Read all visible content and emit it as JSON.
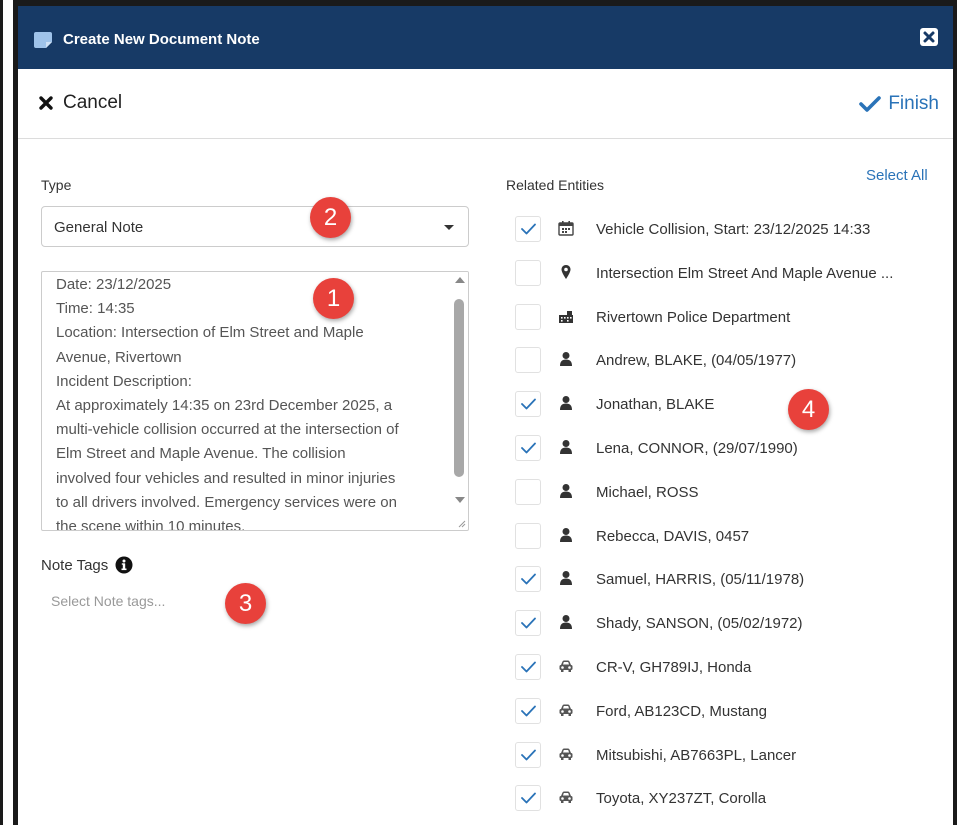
{
  "dialog": {
    "title": "Create New Document Note"
  },
  "toolbar": {
    "cancel_label": "Cancel",
    "finish_label": "Finish"
  },
  "form": {
    "type_label": "Type",
    "type_value": "General Note",
    "note_lines": [
      "Date: 23/12/2025",
      "Time: 14:35",
      "Location: Intersection of Elm Street and Maple",
      "Avenue, Rivertown",
      "Incident Description:",
      "At approximately 14:35 on 23rd December 2025, a",
      "multi-vehicle collision occurred at the intersection of",
      "Elm Street and Maple Avenue. The collision",
      "involved four vehicles and resulted in minor injuries",
      "to all drivers involved. Emergency services were on",
      "the scene within 10 minutes."
    ],
    "note_tags_label": "Note Tags",
    "note_tags_placeholder": "Select Note tags..."
  },
  "related": {
    "label": "Related Entities",
    "select_all": "Select All",
    "entities": [
      {
        "label": "Vehicle Collision, Start: 23/12/2025 14:33",
        "icon": "calendar-icon",
        "checked": true
      },
      {
        "label": "Intersection Elm Street And Maple Avenue ...",
        "icon": "location-pin-icon",
        "checked": false
      },
      {
        "label": "Rivertown Police Department",
        "icon": "building-icon",
        "checked": false
      },
      {
        "label": "Andrew, BLAKE, (04/05/1977)",
        "icon": "person-icon",
        "checked": false
      },
      {
        "label": "Jonathan, BLAKE",
        "icon": "person-icon",
        "checked": true
      },
      {
        "label": "Lena, CONNOR, (29/07/1990)",
        "icon": "person-icon",
        "checked": true
      },
      {
        "label": "Michael, ROSS",
        "icon": "person-icon",
        "checked": false
      },
      {
        "label": "Rebecca, DAVIS, 0457",
        "icon": "person-icon",
        "checked": false
      },
      {
        "label": "Samuel, HARRIS, (05/11/1978)",
        "icon": "person-icon",
        "checked": true
      },
      {
        "label": "Shady, SANSON, (05/02/1972)",
        "icon": "person-icon",
        "checked": true
      },
      {
        "label": "CR-V, GH789IJ, Honda",
        "icon": "car-icon",
        "checked": true
      },
      {
        "label": "Ford, AB123CD, Mustang",
        "icon": "car-icon",
        "checked": true
      },
      {
        "label": "Mitsubishi, AB7663PL, Lancer",
        "icon": "car-icon",
        "checked": true
      },
      {
        "label": "Toyota, XY237ZT, Corolla",
        "icon": "car-icon",
        "checked": true
      }
    ]
  },
  "annotations": {
    "badge_1": "1",
    "badge_2": "2",
    "badge_3": "3",
    "badge_4": "4"
  },
  "colors": {
    "titlebar": "#173a66",
    "accent": "#2a73b8",
    "badge": "#e8413b"
  }
}
